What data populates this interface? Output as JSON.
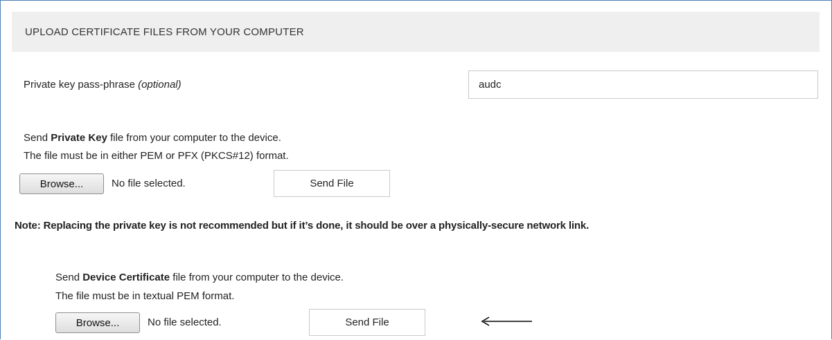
{
  "header": {
    "title": "UPLOAD CERTIFICATE FILES FROM YOUR COMPUTER"
  },
  "passphrase": {
    "label": "Private key pass-phrase",
    "optional": "(optional)",
    "value": "audc"
  },
  "private_key": {
    "line1_prefix": "Send ",
    "line1_bold": "Private Key",
    "line1_suffix": " file from your computer to the device.",
    "line2": "The file must be in either PEM or PFX (PKCS#12) format.",
    "browse_label": "Browse...",
    "file_status": "No file selected.",
    "send_label": "Send File"
  },
  "note": "Note: Replacing the private key is not recommended but if it’s done, it should be over a physically-secure network link.",
  "device_cert": {
    "line1_prefix": "Send ",
    "line1_bold": "Device Certificate",
    "line1_suffix": " file from your computer to the device.",
    "line2": "The file must be in textual PEM format.",
    "browse_label": "Browse...",
    "file_status": "No file selected.",
    "send_label": "Send File"
  },
  "annotation": {
    "icon": "left-arrow-icon"
  }
}
